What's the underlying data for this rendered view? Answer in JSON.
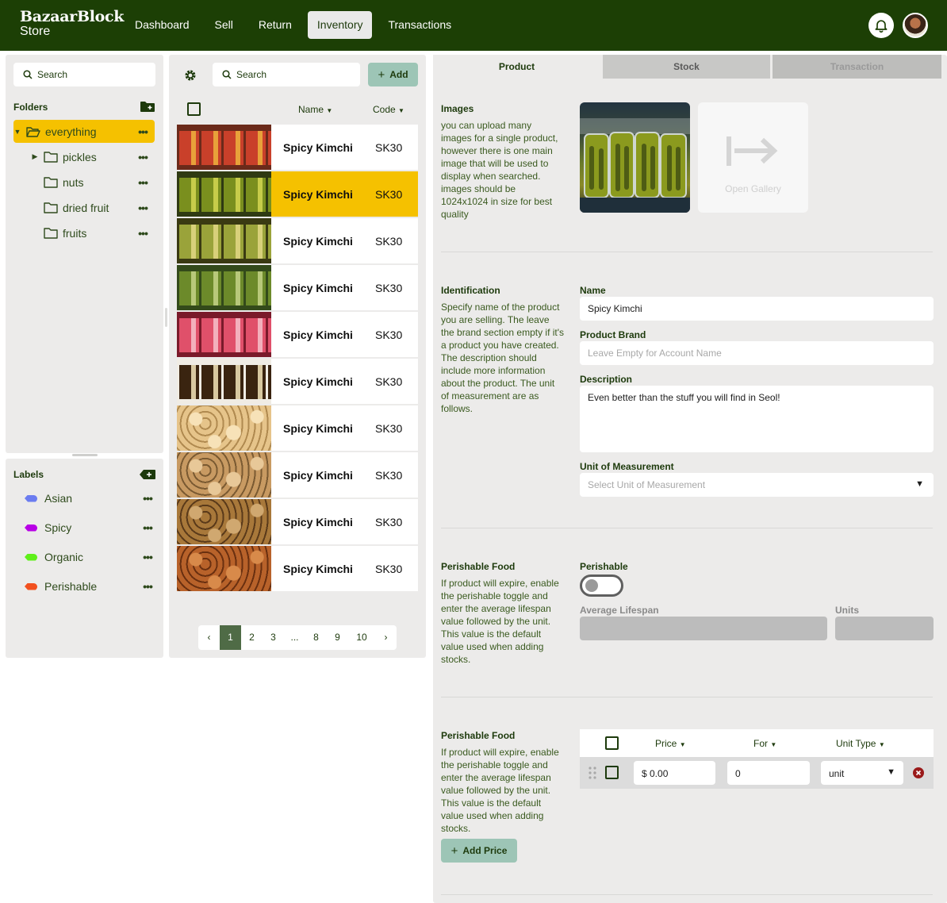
{
  "app": {
    "brand_line1": "BazaarBlock",
    "brand_line2": "Store"
  },
  "nav": {
    "items": [
      "Dashboard",
      "Sell",
      "Return",
      "Inventory",
      "Transactions"
    ],
    "active": "Inventory"
  },
  "folders_panel": {
    "search_placeholder": "Search",
    "folders_title": "Folders",
    "folders": [
      {
        "name": "everything",
        "expanded": true,
        "selected": true
      },
      {
        "name": "pickles",
        "has_children": true
      },
      {
        "name": "nuts"
      },
      {
        "name": "dried fruit"
      },
      {
        "name": "fruits"
      }
    ],
    "labels_title": "Labels",
    "labels": [
      {
        "name": "Asian",
        "color": "#6b7cf0"
      },
      {
        "name": "Spicy",
        "color": "#b800e6"
      },
      {
        "name": "Organic",
        "color": "#5ff01a"
      },
      {
        "name": "Perishable",
        "color": "#f2501f"
      }
    ]
  },
  "product_list": {
    "search_placeholder": "Search",
    "add_label": "Add",
    "col_name": "Name",
    "col_code": "Code",
    "rows": [
      {
        "name": "Spicy Kimchi",
        "code": "SK30",
        "thumb": "kimchi-jars"
      },
      {
        "name": "Spicy Kimchi",
        "code": "SK30",
        "thumb": "pickle-jars",
        "selected": true
      },
      {
        "name": "Spicy Kimchi",
        "code": "SK30",
        "thumb": "asparagus-jars"
      },
      {
        "name": "Spicy Kimchi",
        "code": "SK30",
        "thumb": "cucumber-jars"
      },
      {
        "name": "Spicy Kimchi",
        "code": "SK30",
        "thumb": "radish-jars"
      },
      {
        "name": "Spicy Kimchi",
        "code": "SK30",
        "thumb": "garlic-jars"
      },
      {
        "name": "Spicy Kimchi",
        "code": "SK30",
        "thumb": "peanuts"
      },
      {
        "name": "Spicy Kimchi",
        "code": "SK30",
        "thumb": "cashews"
      },
      {
        "name": "Spicy Kimchi",
        "code": "SK30",
        "thumb": "walnuts"
      },
      {
        "name": "Spicy Kimchi",
        "code": "SK30",
        "thumb": "almonds"
      }
    ],
    "pagination": {
      "prev": "‹",
      "pages": [
        "1",
        "2",
        "3",
        "...",
        "8",
        "9",
        "10"
      ],
      "next": "›",
      "current": "1"
    }
  },
  "detail": {
    "tabs": [
      "Product",
      "Stock",
      "Transaction"
    ],
    "active_tab": "Product",
    "images": {
      "title": "Images",
      "description": "you can upload many images for a single product, however there is one main image that will be used to display when searched. images should be 1024x1024 in size for best quality",
      "open_gallery": "Open Gallery"
    },
    "identification": {
      "title": "Identification",
      "description": "Specify name of the product you are selling. The leave the brand section empty if it's a product you have created. The description should include more information about the product. The unit of measurement are as follows.",
      "name_label": "Name",
      "name_value": "Spicy Kimchi",
      "brand_label": "Product Brand",
      "brand_placeholder": "Leave Empty for Account Name",
      "description_label": "Description",
      "description_value": "Even better than the stuff you will find in Seol!",
      "uom_label": "Unit of Measurement",
      "uom_placeholder": "Select Unit of Measurement"
    },
    "perishable": {
      "title": "Perishable Food",
      "description": "If product will expire, enable the perishable toggle and enter the average lifespan value followed by the unit. This value is the default value used when adding stocks.",
      "toggle_label": "Perishable",
      "toggle_on": false,
      "lifespan_label": "Average Lifespan",
      "units_label": "Units"
    },
    "pricing": {
      "title": "Perishable Food",
      "description": "If product will expire, enable the perishable toggle and enter the average lifespan value followed by the unit. This value is the default value used when adding stocks.",
      "col_price": "Price",
      "col_for": "For",
      "col_unit_type": "Unit Type",
      "row": {
        "price": "$ 0.00",
        "for": "0",
        "unit_type": "unit"
      },
      "add_price_label": "Add Price"
    }
  }
}
